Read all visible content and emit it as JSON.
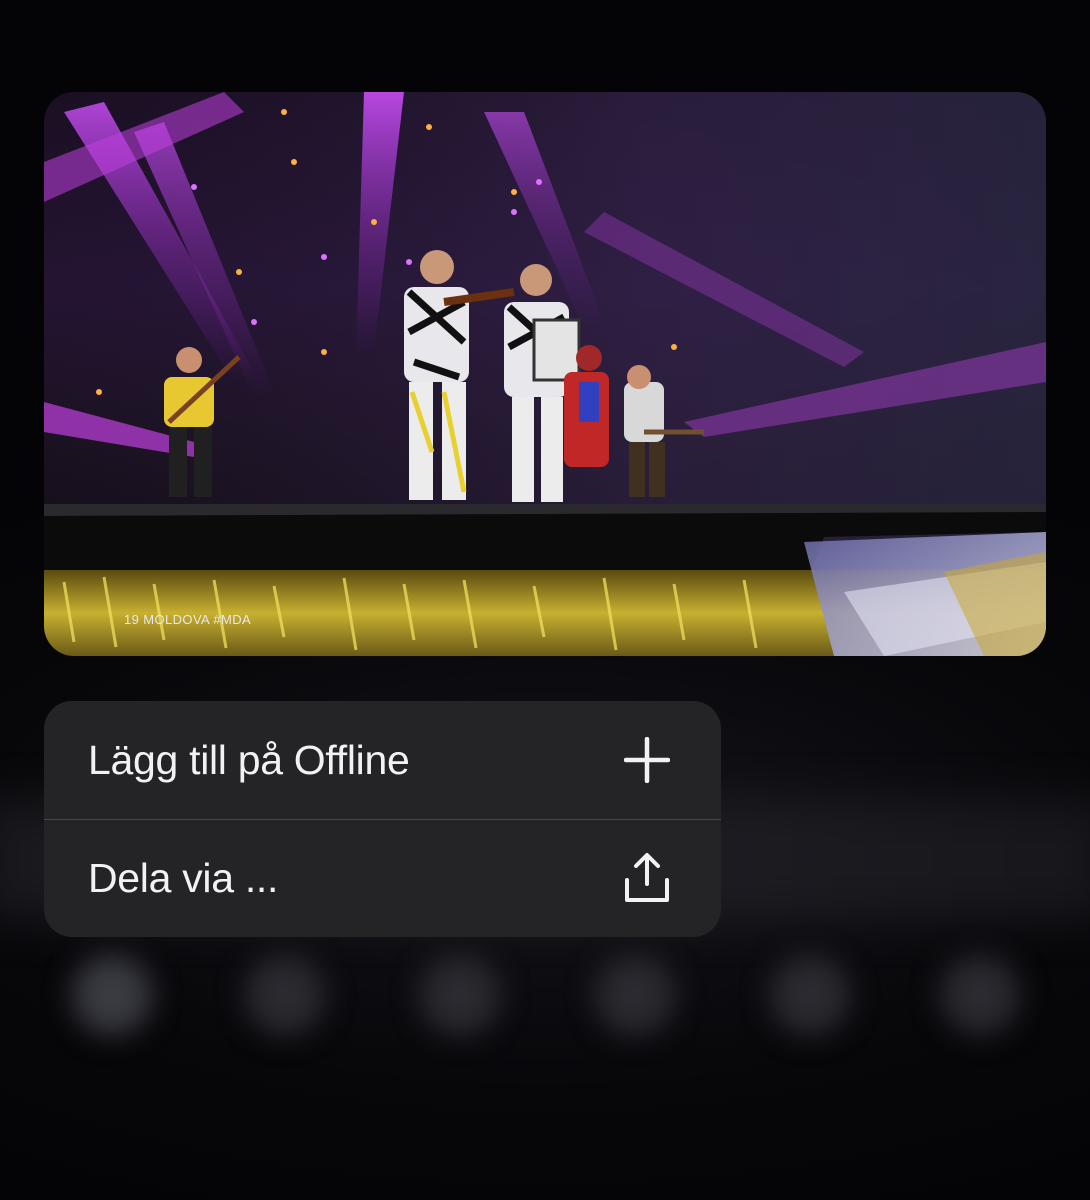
{
  "video": {
    "caption": "19 MOLDOVA #MDA"
  },
  "menu": {
    "items": [
      {
        "label": "Lägg till på Offline",
        "icon": "plus-icon"
      },
      {
        "label": "Dela via ...",
        "icon": "share-icon"
      }
    ]
  },
  "colors": {
    "background": "#050508",
    "menu_background": "#242427",
    "menu_text": "#f2f2f4",
    "stage_lights": "#c040e0"
  }
}
